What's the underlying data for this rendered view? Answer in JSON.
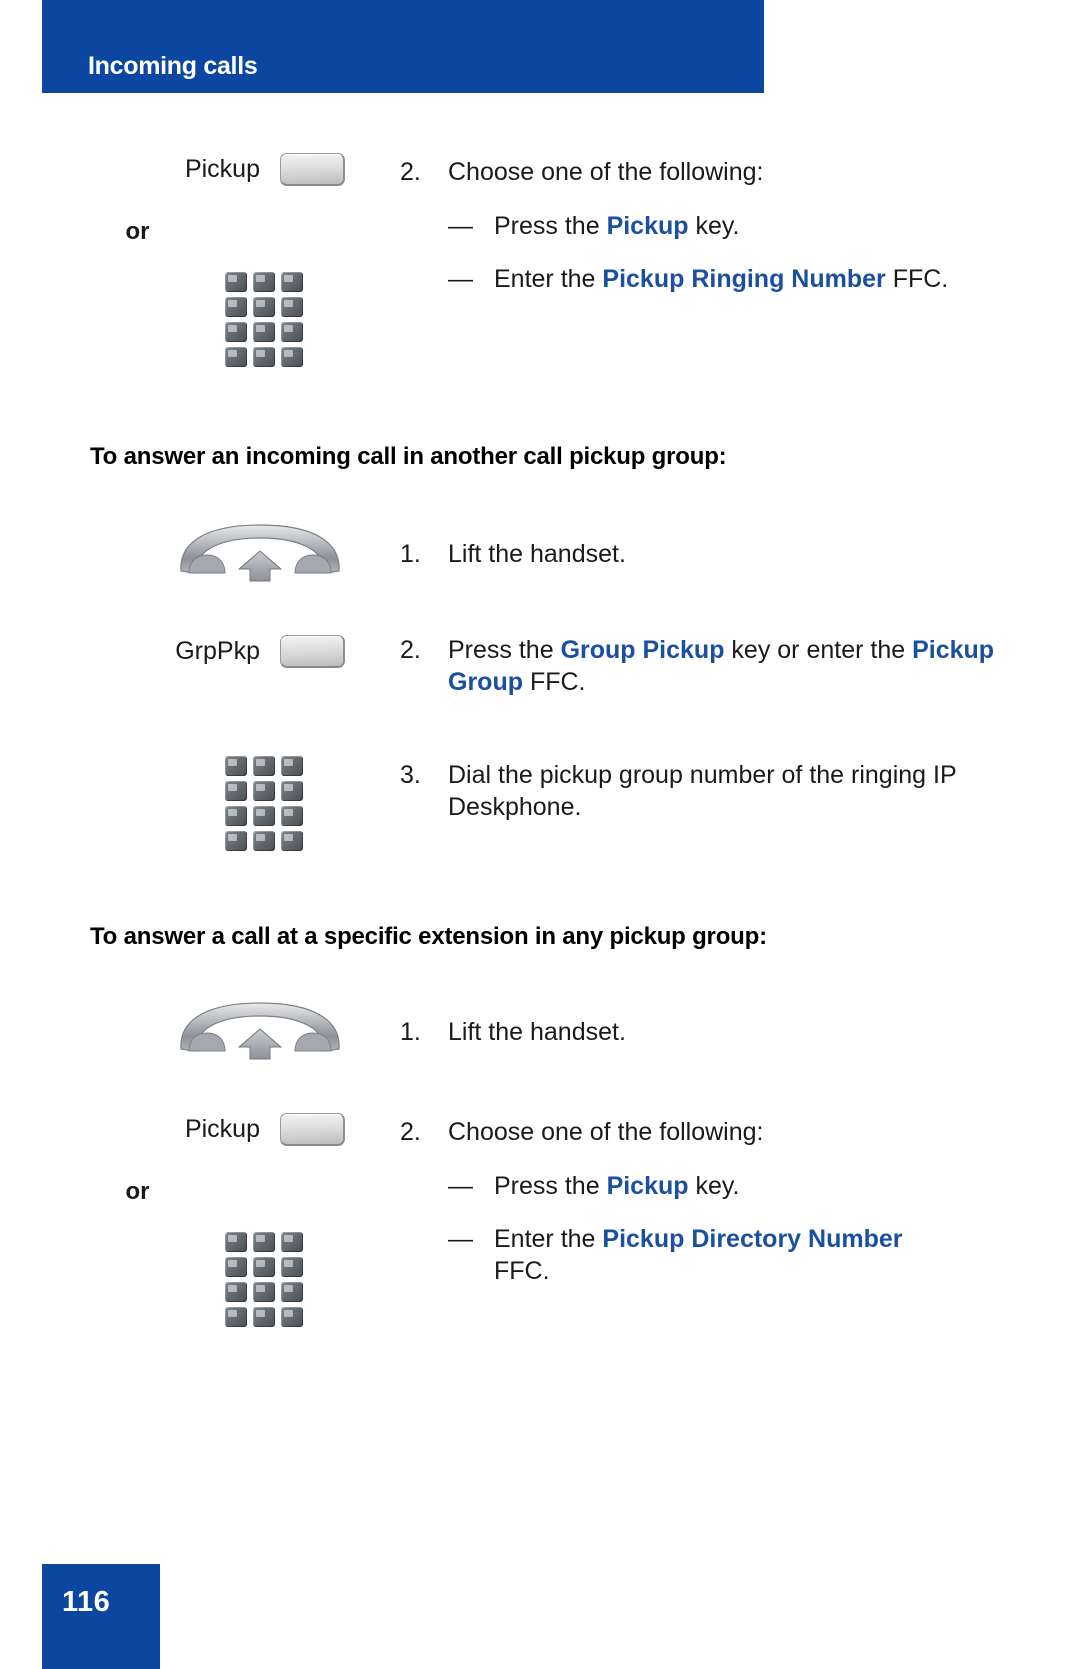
{
  "header": {
    "title": "Incoming calls",
    "bar_color": "#0B47A1"
  },
  "theme": {
    "accent_blue": "#0B47A1",
    "emphasis_blue": "#1B4FA0",
    "text_black": "#1a1a1a"
  },
  "blocks": [
    {
      "id": "block-pickup-same-group",
      "left": {
        "key_label": "Pickup",
        "or_label": "or",
        "icons": [
          "softkey-icon",
          "dialpad-icon"
        ]
      },
      "step": {
        "number": "2.",
        "text": "Choose one of the following:"
      },
      "substeps": [
        {
          "dash": "—",
          "pre": "Press the ",
          "bold": "Pickup",
          "post": " key."
        },
        {
          "dash": "—",
          "pre": "Enter the ",
          "bold": "Pickup Ringing Number",
          "post": " FFC."
        }
      ]
    }
  ],
  "section_another_group": {
    "heading": "To answer an incoming call in another call pickup group:",
    "steps": [
      {
        "number": "1.",
        "text": "Lift the handset.",
        "icon": "handset-icon"
      },
      {
        "number": "2.",
        "pre": "Press the ",
        "bold1": "Group Pickup",
        "mid": " key or enter the ",
        "bold2": "Pickup Group",
        "post": " FFC.",
        "key_label": "GrpPkp",
        "icon": "softkey-icon"
      },
      {
        "number": "3.",
        "text": "Dial the pickup group number of the ringing IP Deskphone.",
        "icon": "dialpad-icon"
      }
    ]
  },
  "section_specific_extension": {
    "heading": "To answer a call at a specific extension in any pickup group:",
    "steps": [
      {
        "number": "1.",
        "text": "Lift the handset.",
        "icon": "handset-icon"
      },
      {
        "number": "2.",
        "text": "Choose one of the following:",
        "key_label": "Pickup",
        "or_label": "or",
        "icons": [
          "softkey-icon",
          "dialpad-icon"
        ],
        "substeps": [
          {
            "dash": "—",
            "pre": "Press the ",
            "bold": "Pickup",
            "post": " key."
          },
          {
            "dash": "—",
            "pre": "Enter the ",
            "bold": "Pickup Directory Number",
            "post": " FFC."
          }
        ]
      }
    ]
  },
  "footer": {
    "page_number": "116"
  }
}
